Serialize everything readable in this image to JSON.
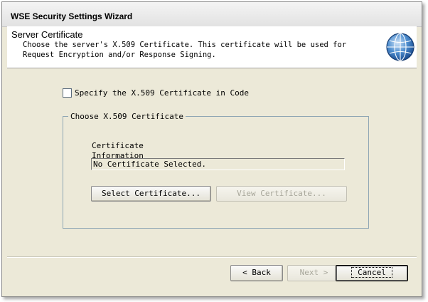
{
  "window": {
    "title": "WSE Security Settings Wizard"
  },
  "header": {
    "title": "Server Certificate",
    "description_line1": "Choose the server's X.509 Certificate. This certificate will be used for",
    "description_line2": "Request Encryption and/or Response Signing.",
    "icon": "globe-icon"
  },
  "options": {
    "specify_in_code_label": "Specify the X.509 Certificate in Code",
    "specify_in_code_checked": false
  },
  "certificate_group": {
    "legend": "Choose X.509 Certificate",
    "info_label_line1": "Certificate",
    "info_label_line2": "Information",
    "info_value": "No Certificate Selected.",
    "select_button": "Select Certificate...",
    "view_button": "View Certificate..."
  },
  "navigation": {
    "back_button": "< Back",
    "next_button": "Next >",
    "cancel_button": "Cancel"
  },
  "colors": {
    "dialog_background": "#ece9d8",
    "header_background": "#ffffff",
    "globe_blue": "#2f6db5"
  }
}
